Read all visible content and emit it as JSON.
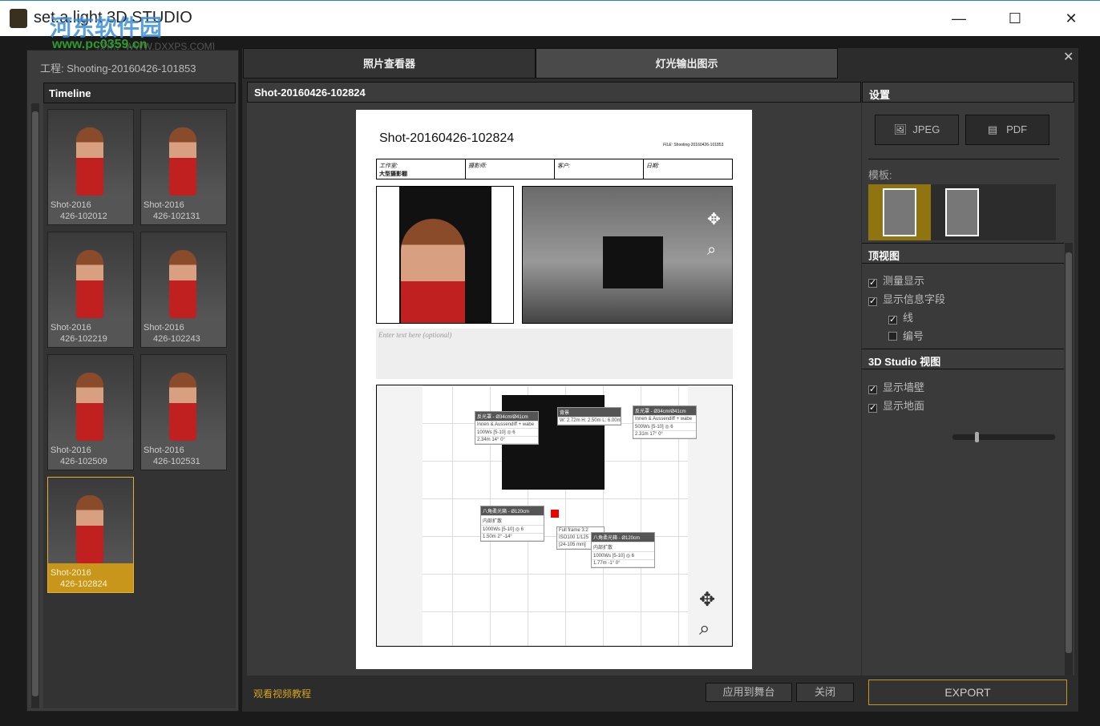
{
  "window": {
    "title": "set.a.light 3D STUDIO",
    "minimize": "—",
    "maximize": "☐",
    "close": "✕"
  },
  "watermark": {
    "cn": "河东软件园",
    "url": "www.pc0359.cn"
  },
  "background_text": "汉化：WWW.DXXPS.COM]",
  "left": {
    "project": "工程: Shooting-20160426-101853",
    "timeline_title": "Timeline",
    "shots": [
      {
        "l1": "Shot-2016",
        "l2": "426-102012"
      },
      {
        "l1": "Shot-2016",
        "l2": "426-102131"
      },
      {
        "l1": "Shot-2016",
        "l2": "426-102219"
      },
      {
        "l1": "Shot-2016",
        "l2": "426-102243"
      },
      {
        "l1": "Shot-2016",
        "l2": "426-102509"
      },
      {
        "l1": "Shot-2016",
        "l2": "426-102531"
      },
      {
        "l1": "Shot-2016",
        "l2": "426-102824",
        "selected": true
      }
    ]
  },
  "tabs": [
    {
      "label": "照片查看器"
    },
    {
      "label": "灯光输出图示",
      "active": true
    }
  ],
  "panel_close": "✕",
  "header": {
    "shot": "Shot-20160426-102824",
    "settings": "设置"
  },
  "sheet": {
    "title": "Shot-20160426-102824",
    "file_label": "FILE:",
    "file_value": "Shooting-20160426-101853",
    "fields": [
      {
        "label": "工作室:",
        "value": "大型摄影棚"
      },
      {
        "label": "摄影师:",
        "value": ""
      },
      {
        "label": "客户:",
        "value": ""
      },
      {
        "label": "日期:",
        "value": ""
      }
    ],
    "notes_placeholder": "Enter text here (optional)",
    "lights": [
      {
        "name": "反光罩 - Ø34cm/Ø41cm",
        "mod": "Innen & Aussendiff + wabe",
        "power": "100Ws [5-10] ◎ 6",
        "pos": "2.34m  14°  0°"
      },
      {
        "name": "背景",
        "mod": "W: 2.72m  H: 2.50m  L: 6.00m",
        "power": "",
        "pos": ""
      },
      {
        "name": "反光罩 - Ø34cm/Ø41cm",
        "mod": "Innen & Aussendiff + wabe",
        "power": "500Ws [5-10] ◎ 6",
        "pos": "2.31m  17°  0°"
      },
      {
        "name": "八角柔光箱 - Ø120cm",
        "mod": "内部扩散",
        "power": "1000Ws [5-10] ◎ 6",
        "pos": "1.50m  2°  -14°"
      },
      {
        "name": "八角柔光箱 - Ø120cm",
        "mod": "内部扩散",
        "power": "1000Ws [5-10] ◎ 6",
        "pos": "1.77m  -1°  0°"
      },
      {
        "name": "Full frame  3:2",
        "mod": "ISO100  1/125",
        "power": "[24-105 mm]",
        "pos": ""
      }
    ]
  },
  "settings": {
    "jpeg": "JPEG",
    "pdf": "PDF",
    "template_label": "模板:",
    "template_selected": 1,
    "top_view": {
      "title": "顶视图",
      "items": [
        {
          "label": "测量显示",
          "checked": true
        },
        {
          "label": "显示信息字段",
          "checked": true
        },
        {
          "label": "线",
          "checked": true
        },
        {
          "label": "编号",
          "checked": false
        }
      ]
    },
    "studio_view": {
      "title": "3D Studio 视图",
      "items": [
        {
          "label": "显示墙壁",
          "checked": true
        },
        {
          "label": "显示地面",
          "checked": true
        }
      ]
    },
    "slider_value": 0.2
  },
  "footer": {
    "tutorial": "观看视频教程",
    "apply": "应用到舞台",
    "close": "关闭",
    "export": "EXPORT"
  },
  "colors": {
    "accent": "#c8961a",
    "template_selected": "#8f7410"
  }
}
